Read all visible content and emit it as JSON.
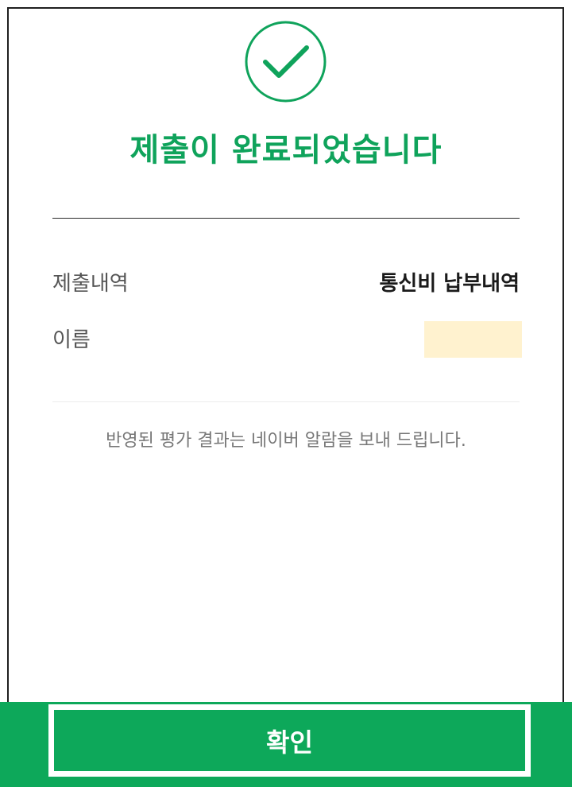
{
  "result": {
    "title": "제출이 완료되었습니다",
    "icon": "check-circle-icon",
    "accent_color": "#0fa35b"
  },
  "details": {
    "submission_label": "제출내역",
    "submission_value": "통신비 납부내역",
    "name_label": "이름",
    "name_value": ""
  },
  "notice": "반영된 평가 결과는 네이버 알람을 보내 드립니다.",
  "footer": {
    "confirm_label": "확인",
    "bar_color": "#0da85a"
  }
}
